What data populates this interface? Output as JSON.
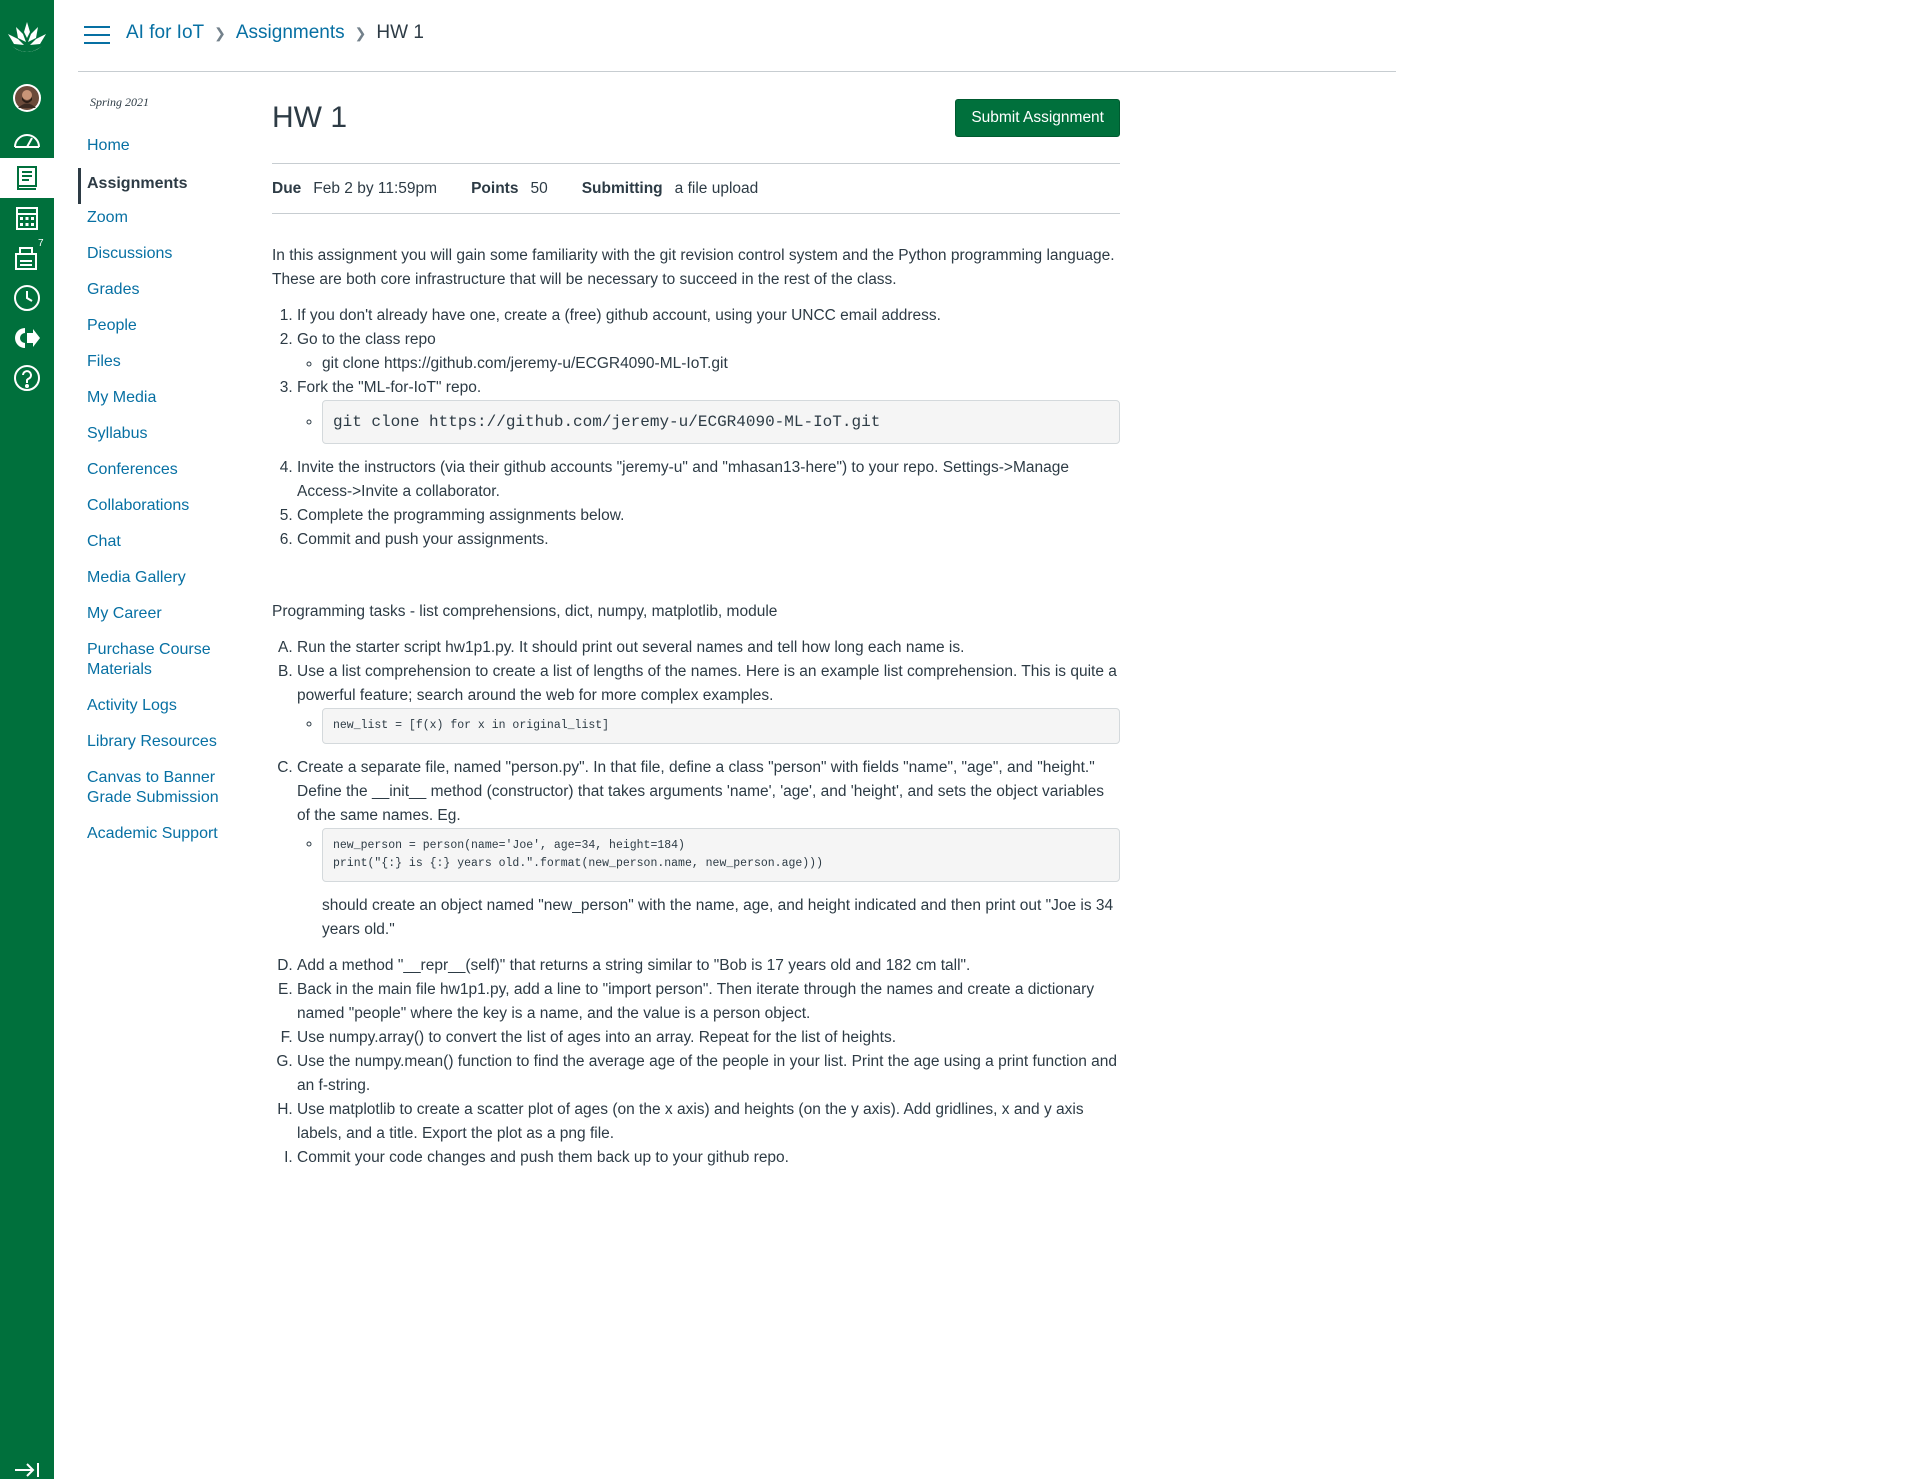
{
  "global_nav": {
    "items": [
      {
        "name": "logo",
        "icon": "university-logo-icon"
      },
      {
        "name": "account",
        "icon": "avatar"
      },
      {
        "name": "dashboard",
        "icon": "dashboard-icon"
      },
      {
        "name": "courses",
        "icon": "courses-icon"
      },
      {
        "name": "calendar",
        "icon": "calendar-icon"
      },
      {
        "name": "inbox",
        "icon": "inbox-icon",
        "badge": "7"
      },
      {
        "name": "history",
        "icon": "clock-icon"
      },
      {
        "name": "commons",
        "icon": "commons-icon"
      },
      {
        "name": "help",
        "icon": "help-icon"
      }
    ],
    "collapse_icon": "collapse-icon",
    "background": "#00703c"
  },
  "breadcrumb": {
    "course": "AI for IoT",
    "section": "Assignments",
    "current": "HW 1"
  },
  "course_nav": {
    "term": "Spring 2021",
    "items": [
      "Home",
      "Assignments",
      "Zoom",
      "Discussions",
      "Grades",
      "People",
      "Files",
      "My Media",
      "Syllabus",
      "Conferences",
      "Collaborations",
      "Chat",
      "Media Gallery",
      "My Career",
      "Purchase Course Materials",
      "Activity Logs",
      "Library Resources",
      "Canvas to Banner Grade Submission",
      "Academic Support"
    ],
    "active": "Assignments"
  },
  "assignment": {
    "title": "HW 1",
    "submit_label": "Submit Assignment",
    "due_label": "Due",
    "due_value": "Feb 2 by 11:59pm",
    "points_label": "Points",
    "points_value": "50",
    "submitting_label": "Submitting",
    "submitting_value": "a file upload"
  },
  "description": {
    "intro": "In this assignment you will gain some familiarity with the git revision control system and the Python programming language.  These are both core infrastructure that will be necessary to succeed in the rest of the class.",
    "steps": [
      "If you don't already have one, create a (free) github account, using your UNCC email address.",
      "Go to the class repo",
      "Fork the \"ML-for-IoT\" repo.",
      "Invite the instructors (via their github accounts \"jeremy-u\" and \"mhasan13-here\") to your repo. Settings->Manage Access->Invite a collaborator.",
      "Complete the programming assignments below.",
      "Commit and push your assignments."
    ],
    "step2_sub": "git clone https://github.com/jeremy-u/ECGR4090-ML-IoT.git",
    "step3_code": "git clone https://github.com/jeremy-u/ECGR4090-ML-IoT.git",
    "tasks_heading": "Programming tasks - list comprehensions, dict, numpy, matplotlib, module",
    "tasks": [
      " Run the starter script hw1p1.py.  It should print out several names and tell how long each name is.",
      " Use a list comprehension to create a list of lengths of the names.  Here is an example list comprehension.  This is quite a powerful feature; search around the web for more complex examples.",
      "Create a separate file, named \"person.py\". In that file, define a class \"person\" with fields \"name\", \"age\", and \"height.\"  Define the __init__ method (constructor) that takes arguments 'name', 'age', and 'height', and sets the object variables of the same names.  Eg.",
      "Add a  method \"__repr__(self)\" that returns a string similar to \"Bob is 17 years old and 182 cm tall\".",
      "Back in the main file hw1p1.py, add a line to \"import person\".  Then iterate through the names and create a dictionary named \"people\" where the key is a name, and the value is a person object.",
      "Use numpy.array() to convert the list of ages into an array.  Repeat for the list of heights.",
      "Use the numpy.mean() function to find the average age of the people in your list.  Print the age using a print function and an f-string.",
      "Use matplotlib to create a scatter plot of ages (on the x axis) and heights (on the y axis).  Add gridlines, x and y axis labels, and a title.  Export the plot as a png file.",
      "Commit your code changes and push them back up to your github repo."
    ],
    "task_b_code": "new_list = [f(x) for x in original_list]",
    "task_c_code": "new_person = person(name='Joe', age=34, height=184)\nprint(\"{:} is {:} years old.\".format(new_person.name, new_person.age)))",
    "task_c_after": "should create an object named \"new_person\" with the name, age, and height indicated and then print out \"Joe is 34 years old.\""
  }
}
